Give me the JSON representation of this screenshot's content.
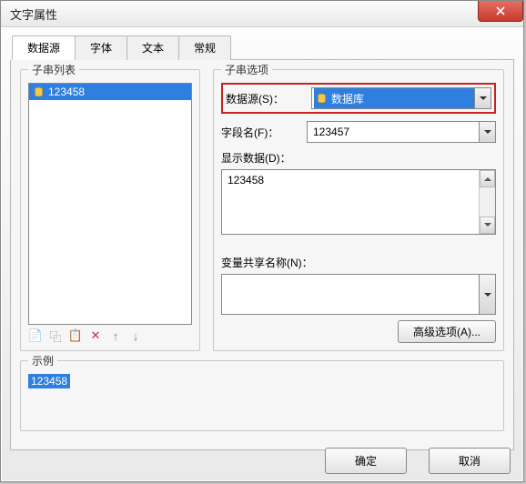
{
  "window": {
    "title": "文字属性"
  },
  "tabs": {
    "data_source": "数据源",
    "font": "字体",
    "text": "文本",
    "general": "常规"
  },
  "left": {
    "legend": "子串列表",
    "items": [
      {
        "label": "123458"
      }
    ],
    "icons": {
      "new": "new-icon",
      "copy": "copy-icon",
      "cut": "cut-icon",
      "delete": "delete-icon",
      "up": "up-icon",
      "down": "down-icon"
    }
  },
  "right": {
    "legend": "子串选项",
    "ds_label": "数据源(S)：",
    "ds_value": "数据库",
    "field_label": "字段名(F)：",
    "field_value": "123457",
    "display_label": "显示数据(D)：",
    "display_value": "123458",
    "share_label": "变量共享名称(N)：",
    "share_value": "",
    "adv_button": "高级选项(A)..."
  },
  "example": {
    "legend": "示例",
    "value": "123458"
  },
  "buttons": {
    "ok": "确定",
    "cancel": "取消"
  }
}
